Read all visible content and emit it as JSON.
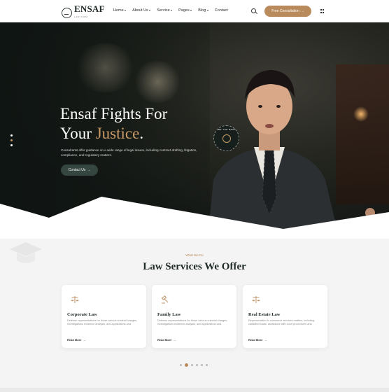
{
  "header": {
    "logo_text": "ENSAF",
    "logo_tagline": "LAW FIRM",
    "nav": [
      {
        "label": "Home",
        "has_dropdown": true
      },
      {
        "label": "About Us",
        "has_dropdown": true
      },
      {
        "label": "Service",
        "has_dropdown": true
      },
      {
        "label": "Pages",
        "has_dropdown": true
      },
      {
        "label": "Blog",
        "has_dropdown": true
      },
      {
        "label": "Contact",
        "has_dropdown": false
      }
    ],
    "cta_label": "Free Consultation",
    "cta_arrow": "→"
  },
  "hero": {
    "title_line1": "Ensaf Fights For",
    "title_line2_prefix": "Your ",
    "title_line2_accent": "Justice",
    "title_line2_suffix": ".",
    "subtitle": "Consultants offer guidance on a wide range of legal issues, including contract drafting, litigation, compliance, and regulatory matters.",
    "button_label": "Contact Us",
    "button_arrow": "→",
    "badge_text": "BE THE BEST",
    "slider_dots": 3,
    "active_dot": 1
  },
  "services": {
    "eyebrow": "What We Do",
    "title": "Law Services We Offer",
    "cards": [
      {
        "icon": "scale-icon",
        "title": "Corporate Law",
        "text": "Defense representations for those various criminal charges, investigations evidence analysis, and applications and.",
        "link": "Read More"
      },
      {
        "icon": "gavel-icon",
        "title": "Family Law",
        "text": "Defense representations for those various criminal charges, investigations evidence analysis, and applications and.",
        "link": "Read More"
      },
      {
        "icon": "scale-icon",
        "title": "Real Estate Law",
        "text": "Representation in commerce services matters, including classified loads, assistance with court procedures and.",
        "link": "Read More"
      }
    ],
    "pager_count": 6,
    "pager_active": 1
  },
  "colors": {
    "accent_gold": "#b98b5c",
    "dark_green": "#354640",
    "hero_bg": "#1a1d19"
  }
}
